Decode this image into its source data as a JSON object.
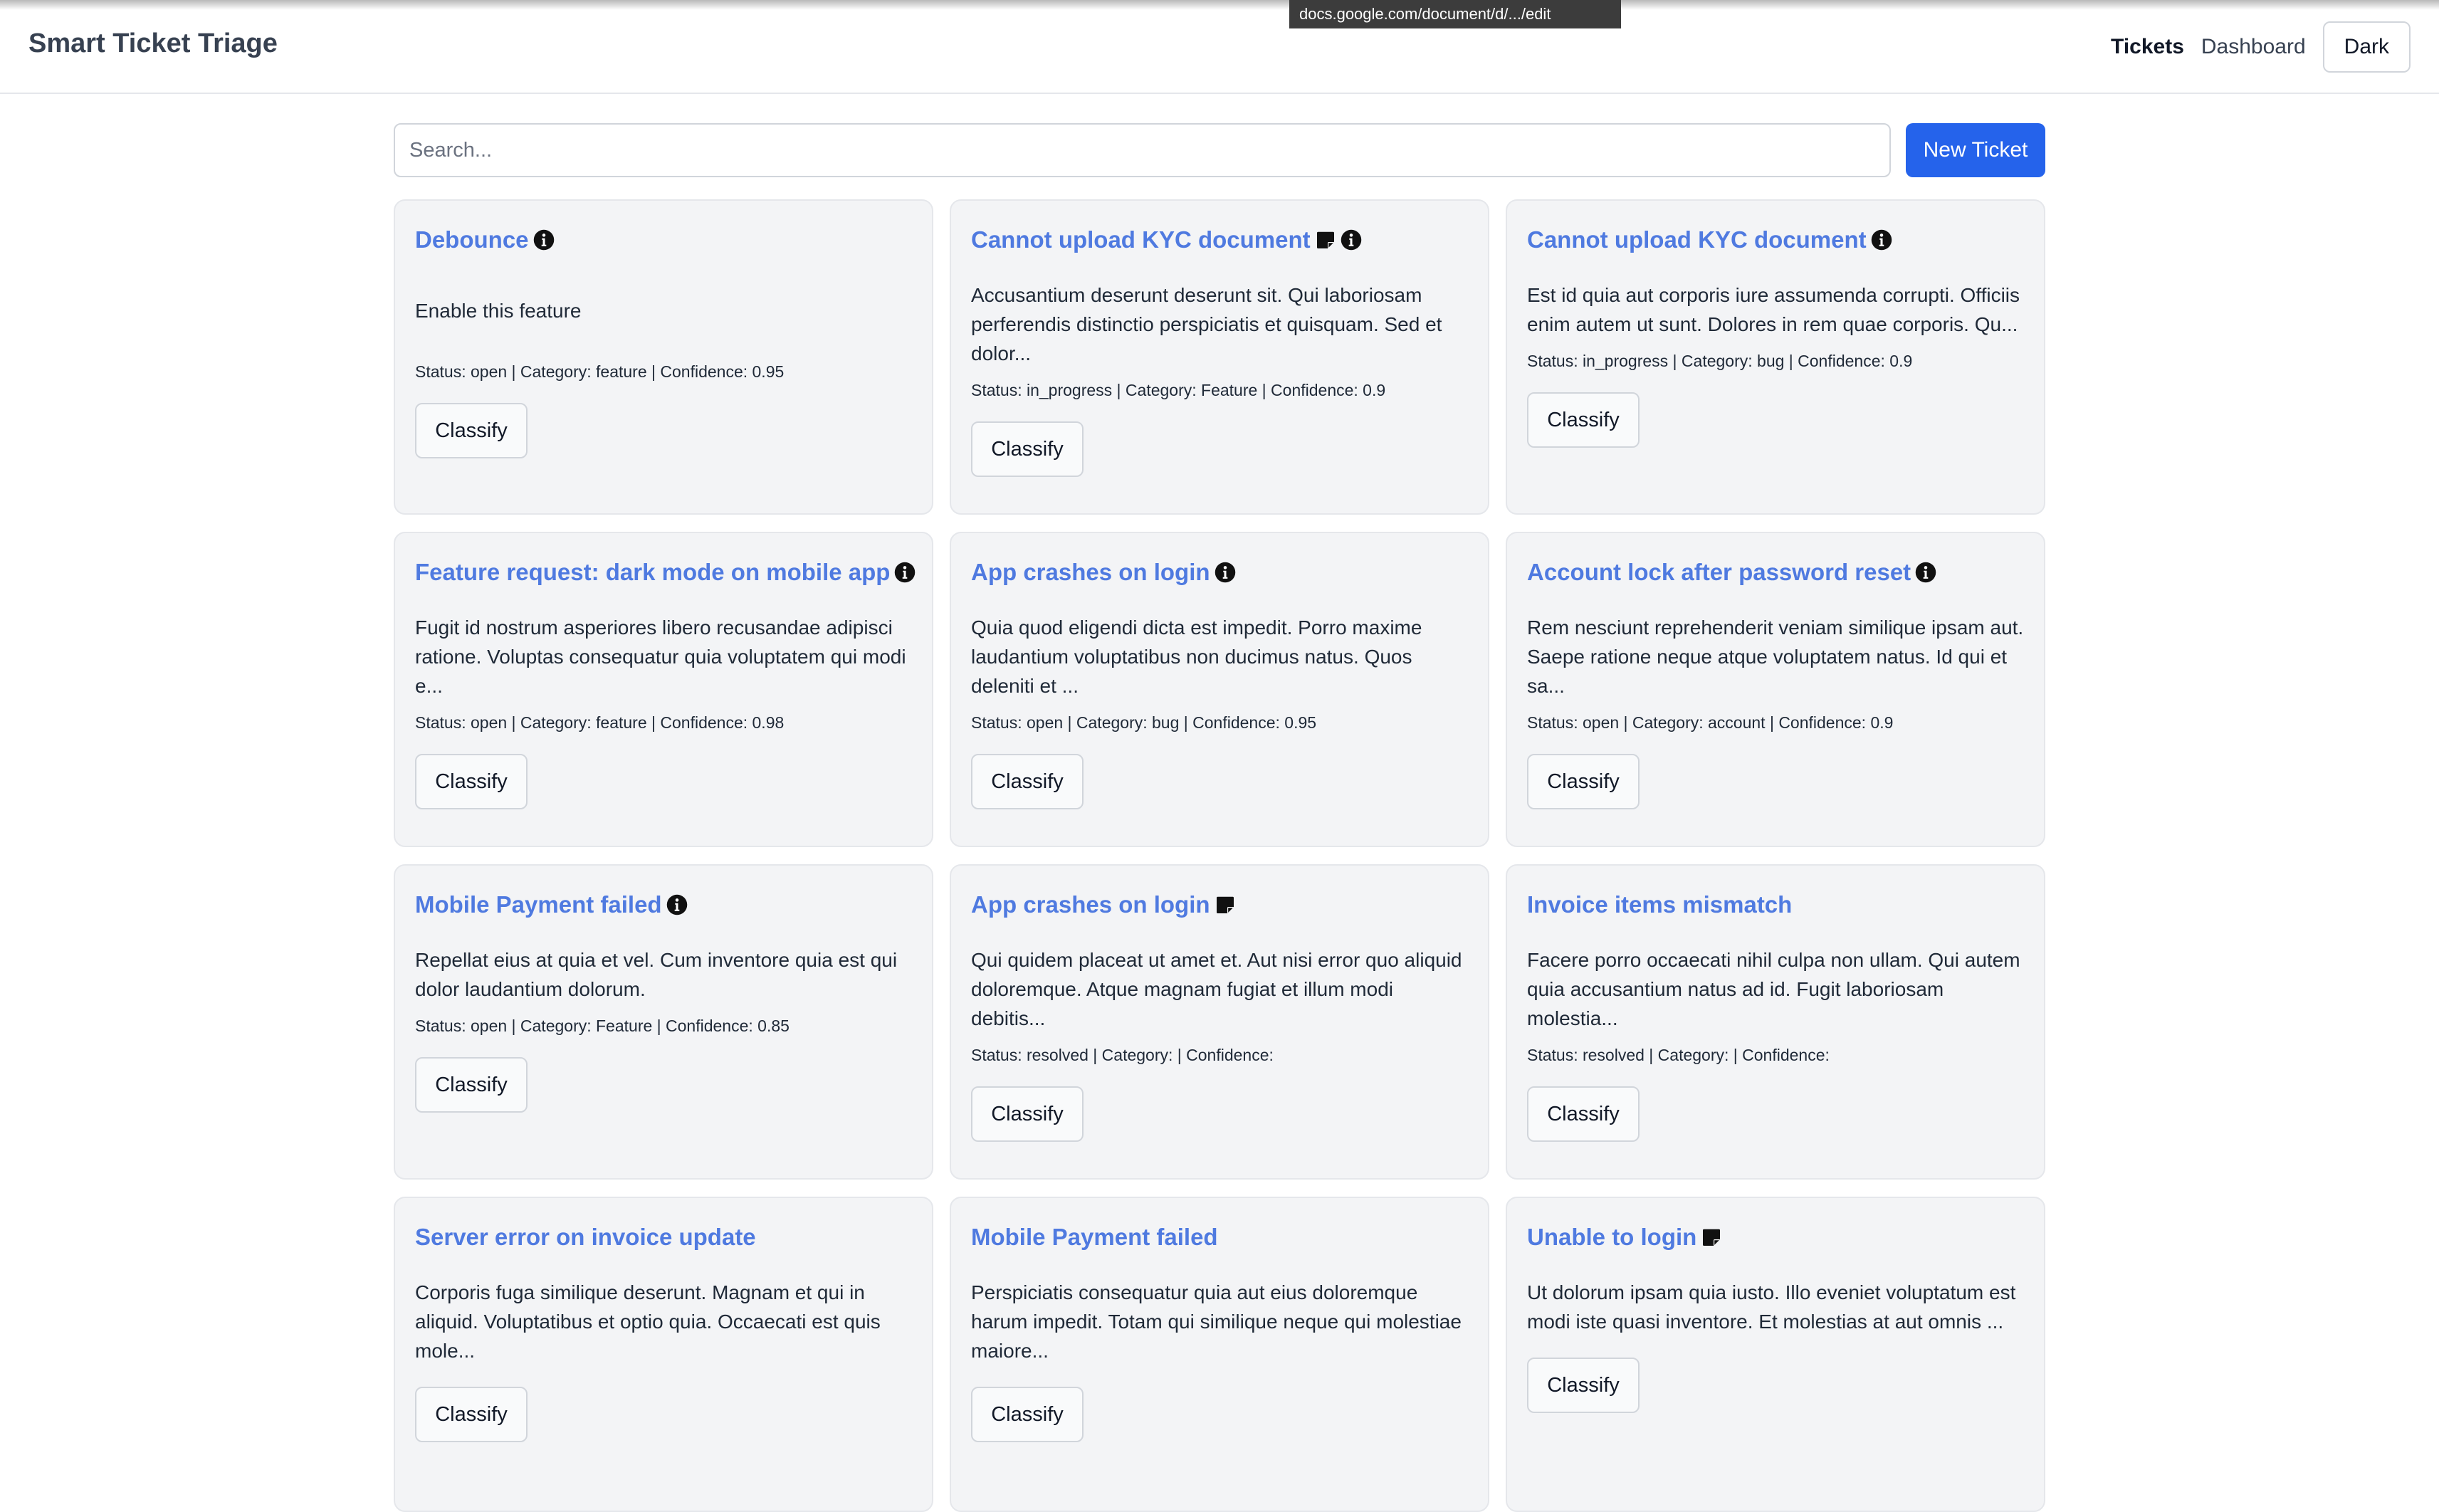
{
  "tooltip": {
    "url": "docs.google.com/document/d/.../edit"
  },
  "header": {
    "brand": "Smart Ticket Triage",
    "nav": {
      "tickets": "Tickets",
      "dashboard": "Dashboard",
      "dark": "Dark"
    }
  },
  "search": {
    "placeholder": "Search...",
    "value": ""
  },
  "actions": {
    "new_ticket": "New Ticket",
    "classify": "Classify"
  },
  "icons": {
    "info": "info-circle-icon",
    "note": "sticky-note-icon"
  },
  "tickets": [
    {
      "title": "Debounce",
      "icons": [
        "info"
      ],
      "description": "Enable this feature",
      "meta": "Status: open | Category: feature | Confidence: 0.95"
    },
    {
      "title": "Cannot upload KYC document",
      "icons": [
        "note",
        "info"
      ],
      "description": "Accusantium deserunt deserunt sit. Qui laboriosam perferendis distinctio perspiciatis et quisquam. Sed et dolor...",
      "meta": "Status: in_progress | Category: Feature | Confidence: 0.9"
    },
    {
      "title": "Cannot upload KYC document",
      "icons": [
        "info"
      ],
      "description": "Est id quia aut corporis iure assumenda corrupti. Officiis enim autem ut sunt. Dolores in rem quae corporis. Qu...",
      "meta": "Status: in_progress | Category: bug | Confidence: 0.9"
    },
    {
      "title": "Feature request: dark mode on mobile app",
      "icons": [
        "info"
      ],
      "description": "Fugit id nostrum asperiores libero recusandae adipisci ratione. Voluptas consequatur quia voluptatem qui modi e...",
      "meta": "Status: open | Category: feature | Confidence: 0.98"
    },
    {
      "title": "App crashes on login",
      "icons": [
        "info"
      ],
      "description": "Quia quod eligendi dicta est impedit. Porro maxime laudantium voluptatibus non ducimus natus. Quos deleniti et ...",
      "meta": "Status: open | Category: bug | Confidence: 0.95"
    },
    {
      "title": "Account lock after password reset",
      "icons": [
        "info"
      ],
      "description": "Rem nesciunt reprehenderit veniam similique ipsam aut. Saepe ratione neque atque voluptatem natus. Id qui et sa...",
      "meta": "Status: open | Category: account | Confidence: 0.9"
    },
    {
      "title": "Mobile Payment failed",
      "icons": [
        "info"
      ],
      "description": "Repellat eius at quia et vel. Cum inventore quia est qui dolor laudantium dolorum.",
      "meta": "Status: open | Category: Feature | Confidence: 0.85"
    },
    {
      "title": "App crashes on login",
      "icons": [
        "note"
      ],
      "description": "Qui quidem placeat ut amet et. Aut nisi error quo aliquid doloremque. Atque magnam fugiat et illum modi debitis...",
      "meta": "Status: resolved | Category: | Confidence:"
    },
    {
      "title": "Invoice items mismatch",
      "icons": [],
      "description": "Facere porro occaecati nihil culpa non ullam. Qui autem quia accusantium natus ad id. Fugit laboriosam molestia...",
      "meta": "Status: resolved | Category: | Confidence:"
    },
    {
      "title": "Server error on invoice update",
      "icons": [],
      "description": "Corporis fuga similique deserunt. Magnam et qui in aliquid. Voluptatibus et optio quia. Occaecati est quis mole...",
      "meta": ""
    },
    {
      "title": "Mobile Payment failed",
      "icons": [],
      "description": "Perspiciatis consequatur quia aut eius doloremque harum impedit. Totam qui similique neque qui molestiae maiore...",
      "meta": ""
    },
    {
      "title": "Unable to login",
      "icons": [
        "note"
      ],
      "description": "Ut dolorum ipsam quia iusto. Illo eveniet voluptatum est modi iste quasi inventore. Et molestias at aut omnis ...",
      "meta": ""
    }
  ]
}
